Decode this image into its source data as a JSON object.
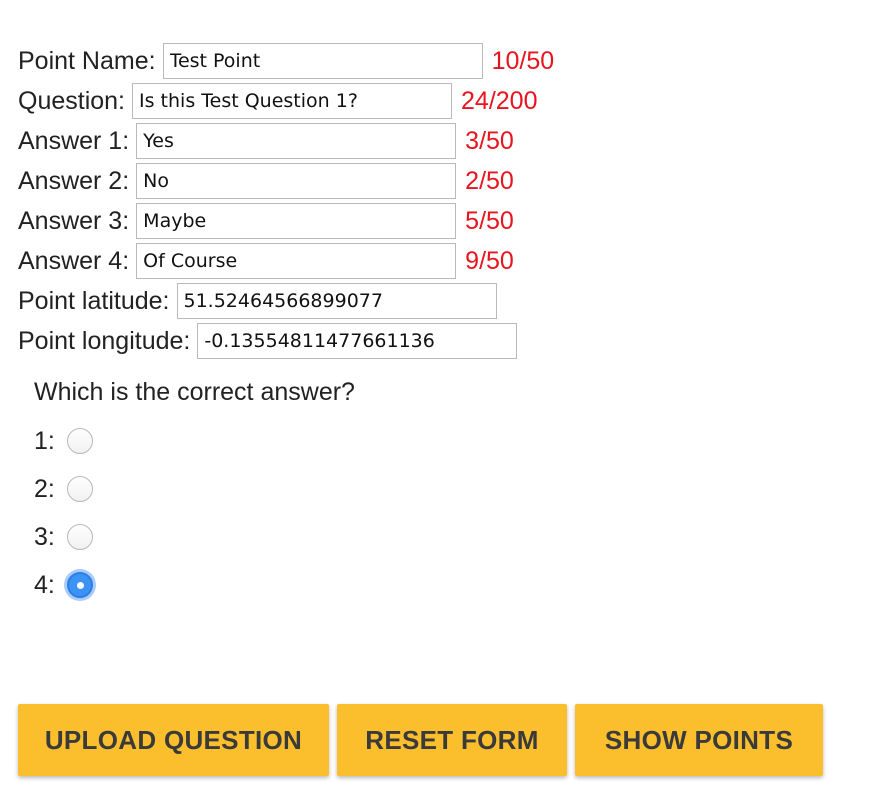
{
  "form": {
    "fields": [
      {
        "label": "Point Name:",
        "value": "Test Point",
        "count": "10/50"
      },
      {
        "label": "Question:",
        "value": "Is this Test Question 1?",
        "count": "24/200"
      },
      {
        "label": "Answer 1:",
        "value": "Yes",
        "count": "3/50"
      },
      {
        "label": "Answer 2:",
        "value": "No",
        "count": "2/50"
      },
      {
        "label": "Answer 3:",
        "value": "Maybe",
        "count": "5/50"
      },
      {
        "label": "Answer 4:",
        "value": "Of Course",
        "count": "9/50"
      },
      {
        "label": "Point latitude:",
        "value": "51.52464566899077"
      },
      {
        "label": "Point longitude:",
        "value": "-0.13554811477661136"
      }
    ],
    "correct_answer": {
      "prompt": "Which is the correct answer?",
      "options": [
        {
          "label": "1:",
          "checked": false
        },
        {
          "label": "2:",
          "checked": false
        },
        {
          "label": "3:",
          "checked": false
        },
        {
          "label": "4:",
          "checked": true
        }
      ]
    }
  },
  "buttons": {
    "upload": "UPLOAD QUESTION",
    "reset": "RESET FORM",
    "show": "SHOW POINTS"
  },
  "colors": {
    "counter": "#e8141e",
    "button": "#fbbe2d",
    "radio_selected": "#3b93f5"
  }
}
